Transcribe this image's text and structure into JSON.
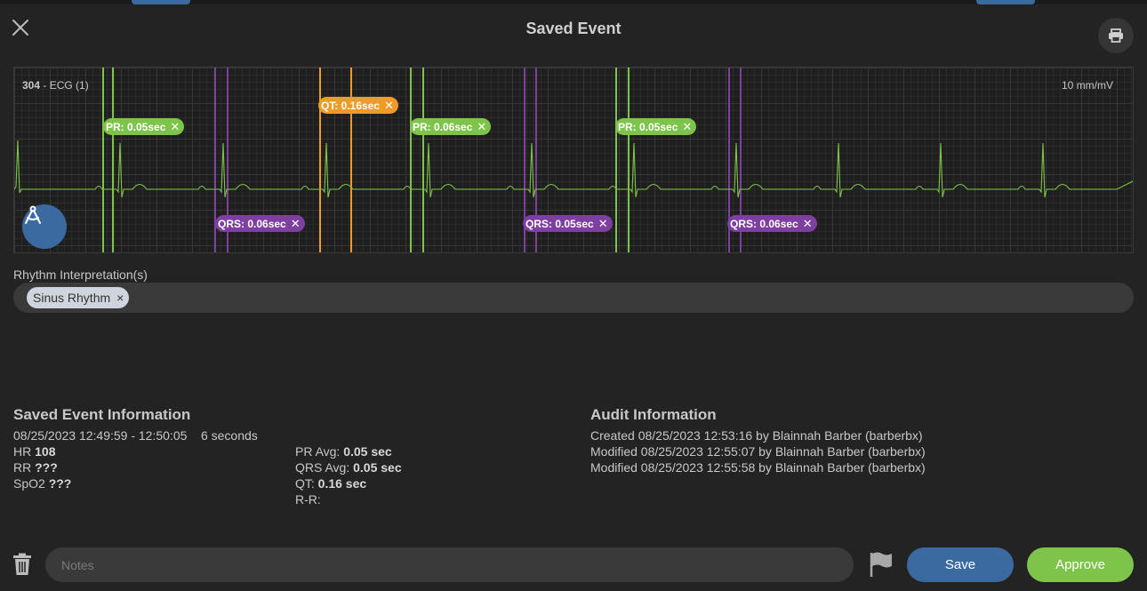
{
  "window": {
    "title": "Saved Event"
  },
  "ecg": {
    "lead_number": "304",
    "lead_name": " - ECG (1)",
    "scale": "10 mm/mV",
    "trace_color": "#7fc44a",
    "measurements": [
      {
        "type": "pr",
        "label": "PR: 0.05sec",
        "color": "#7fc44a"
      },
      {
        "type": "qt",
        "label": "QT: 0.16sec",
        "color": "#f09a2a"
      },
      {
        "type": "pr",
        "label": "PR: 0.06sec",
        "color": "#7fc44a"
      },
      {
        "type": "pr",
        "label": "PR: 0.05sec",
        "color": "#7fc44a"
      },
      {
        "type": "qrs",
        "label": "QRS: 0.06sec",
        "color": "#7d3fa0"
      },
      {
        "type": "qrs",
        "label": "QRS: 0.05sec",
        "color": "#7d3fa0"
      },
      {
        "type": "qrs",
        "label": "QRS: 0.06sec",
        "color": "#7d3fa0"
      }
    ],
    "remove_glyph": "✕"
  },
  "rhythm": {
    "label": "Rhythm Interpretation(s)",
    "chips": [
      {
        "label": "Sinus Rhythm",
        "remove": "×"
      }
    ]
  },
  "saved_event": {
    "title": "Saved Event Information",
    "time_range": "08/25/2023 12:49:59 - 12:50:05",
    "duration": "6 seconds",
    "hr_label": "HR",
    "hr_value": "108",
    "rr_label": "RR",
    "rr_value": "???",
    "spo2_label": "SpO2",
    "spo2_value": "???",
    "pr_avg_label": "PR Avg:",
    "pr_avg_value": "0.05 sec",
    "qrs_avg_label": "QRS Avg:",
    "qrs_avg_value": "0.05 sec",
    "qt_label": "QT:",
    "qt_value": "0.16 sec",
    "rr_interval_label": "R-R:"
  },
  "audit": {
    "title": "Audit Information",
    "entries": [
      "Created 08/25/2023 12:53:16 by Blainnah Barber (barberbx)",
      "Modified 08/25/2023 12:55:07 by Blainnah Barber (barberbx)",
      "Modified 08/25/2023 12:55:58 by Blainnah Barber (barberbx)"
    ]
  },
  "footer": {
    "notes_placeholder": "Notes",
    "save_label": "Save",
    "approve_label": "Approve"
  },
  "colors": {
    "accent_blue": "#3b6aa0",
    "accent_green": "#7fc44a",
    "qt_orange": "#f09a2a",
    "qrs_purple": "#7d3fa0"
  }
}
